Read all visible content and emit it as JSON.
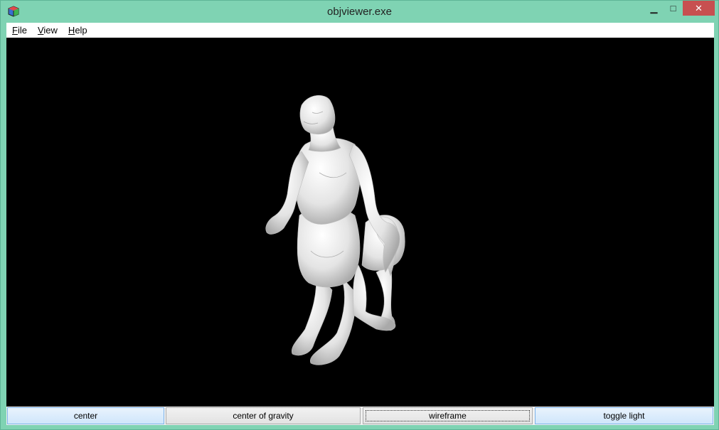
{
  "window": {
    "title": "objviewer.exe"
  },
  "titlebar": {
    "minimize_glyph": "▁",
    "maximize_glyph": "□",
    "close_glyph": "✕"
  },
  "menu": [
    {
      "label": "File",
      "accel": "F",
      "rest": "ile"
    },
    {
      "label": "View",
      "accel": "V",
      "rest": "iew"
    },
    {
      "label": "Help",
      "accel": "H",
      "rest": "elp"
    }
  ],
  "viewport": {
    "background": "#000000",
    "model": "centaur-mesh"
  },
  "buttons": [
    {
      "label": "center"
    },
    {
      "label": "center of gravity"
    },
    {
      "label": "wireframe"
    },
    {
      "label": "toggle light"
    }
  ],
  "colors": {
    "frame": "#7fd3b3",
    "close": "#c75050",
    "button_hot": "#cfe6fb"
  }
}
